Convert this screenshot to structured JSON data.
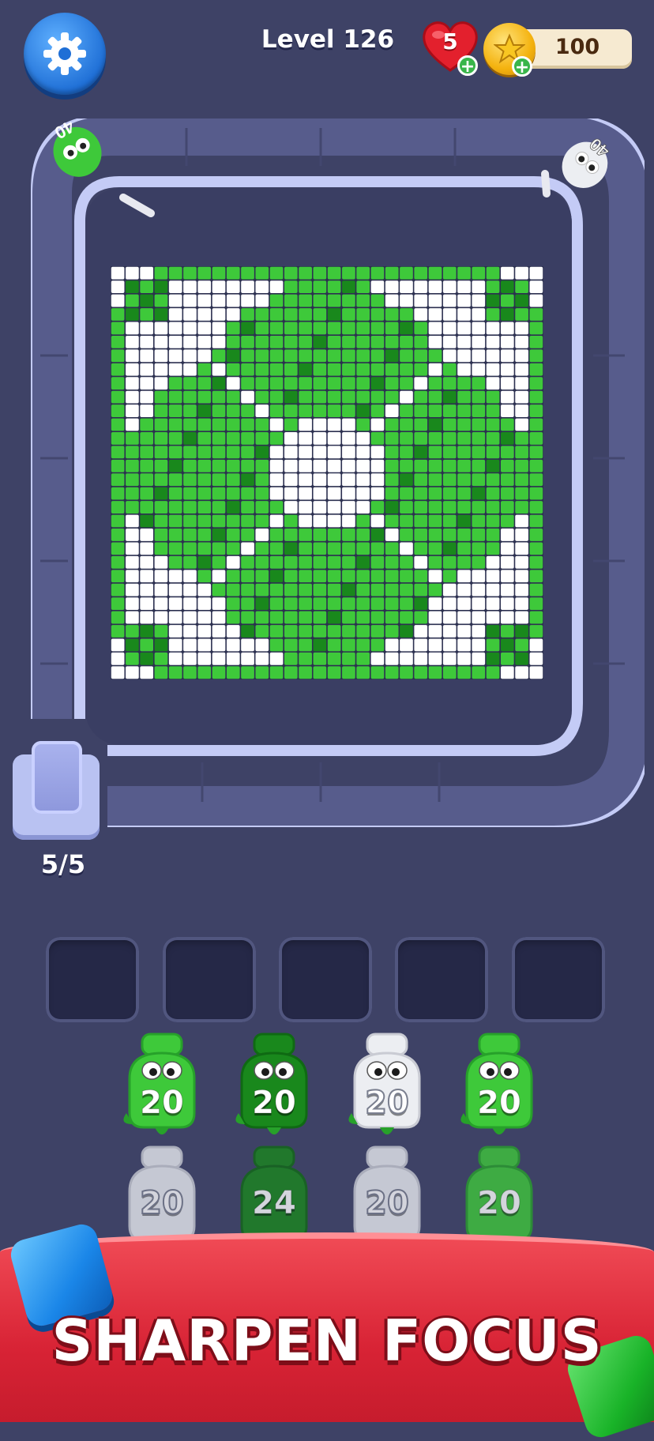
{
  "header": {
    "settings_icon": "gear-icon",
    "level_title": "Level 126",
    "lives": "5",
    "coins": "100",
    "add_icon": "+"
  },
  "board": {
    "track_shooters": [
      {
        "count": "40",
        "color": "light-green"
      },
      {
        "count": "40",
        "color": "white"
      }
    ],
    "picture": "four-leaf-clover"
  },
  "queue": {
    "count": "5/5"
  },
  "slots_count": 5,
  "shooters": [
    {
      "count": "20",
      "color": "#3ec93a",
      "style": "light-green",
      "dim": false
    },
    {
      "count": "20",
      "color": "#19881c",
      "style": "dark-green",
      "dim": false
    },
    {
      "count": "20",
      "color": "#eceef2",
      "style": "white",
      "dim": false
    },
    {
      "count": "20",
      "color": "#3ec93a",
      "style": "light-green",
      "dim": false
    },
    {
      "count": "20",
      "color": "#eceef2",
      "style": "white",
      "dim": true
    },
    {
      "count": "24",
      "color": "#19881c",
      "style": "dark-green",
      "dim": true
    },
    {
      "count": "20",
      "color": "#eceef2",
      "style": "white",
      "dim": true
    },
    {
      "count": "20",
      "color": "#3ec93a",
      "style": "light-green",
      "dim": true
    }
  ],
  "banner": {
    "text": "SHARPEN FOCUS"
  },
  "colors": {
    "background": "#3e4266",
    "track": "#575c8c",
    "track_border": "#c4cbf6",
    "pixel_white": "#ffffff",
    "pixel_light_green": "#3ec93a",
    "pixel_dark_green": "#19881c",
    "banner_red": "#d82335"
  }
}
